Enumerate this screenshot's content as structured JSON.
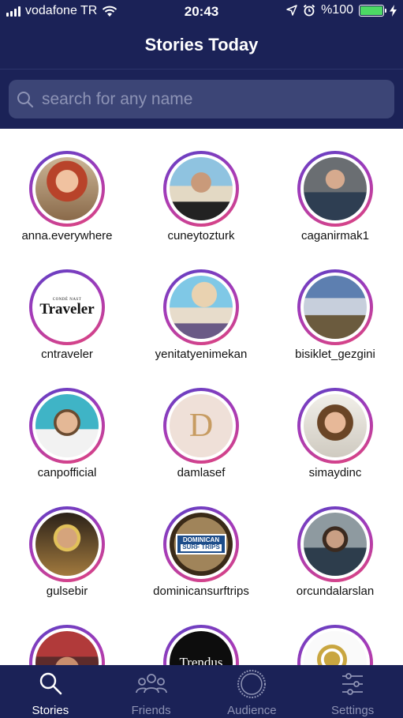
{
  "status_bar": {
    "carrier": "vodafone TR",
    "time": "20:43",
    "battery_percent": "%100",
    "battery_level": 1.0
  },
  "header": {
    "title": "Stories Today"
  },
  "search": {
    "placeholder": "search for any name"
  },
  "stories": [
    {
      "username": "anna.everywhere",
      "avatar": "woman-red-hair"
    },
    {
      "username": "cuneytozturk",
      "avatar": "man-beach-sunglasses"
    },
    {
      "username": "caganirmak1",
      "avatar": "man-bald-arms-crossed"
    },
    {
      "username": "cntraveler",
      "avatar": "logo-traveler",
      "logo_top": "CONDÉ NAST",
      "logo_main": "Traveler"
    },
    {
      "username": "yenitatyenimekan",
      "avatar": "woman-hat-beach"
    },
    {
      "username": "bisiklet_gezgini",
      "avatar": "bicycles-sky"
    },
    {
      "username": "canpofficial",
      "avatar": "man-smiling-sea"
    },
    {
      "username": "damlasef",
      "avatar": "logo-letter-d",
      "logo_main": "D"
    },
    {
      "username": "simaydinc",
      "avatar": "woman-smiling"
    },
    {
      "username": "gulsebir",
      "avatar": "woman-short-hair"
    },
    {
      "username": "dominicansurftrips",
      "avatar": "logo-dominican-surf",
      "logo_line1": "DOMINICAN",
      "logo_line2": "SURF TRIPS"
    },
    {
      "username": "orcundalarslan",
      "avatar": "man-beard-mountain"
    },
    {
      "username": "",
      "avatar": "person-sunglasses-headwrap"
    },
    {
      "username": "",
      "avatar": "logo-trendus",
      "logo_main": "Trendus"
    },
    {
      "username": "",
      "avatar": "logo-bird"
    }
  ],
  "tabbar": {
    "tabs": [
      {
        "label": "Stories",
        "icon": "search-icon",
        "active": true
      },
      {
        "label": "Friends",
        "icon": "people-icon",
        "active": false
      },
      {
        "label": "Audience",
        "icon": "circle-icon",
        "active": false
      },
      {
        "label": "Settings",
        "icon": "sliders-icon",
        "active": false
      }
    ]
  },
  "colors": {
    "header_bg": "#1b2257",
    "search_bg": "#3c4576",
    "ring_gradient": [
      "#5b3fc4",
      "#a63bb8",
      "#e0457d"
    ],
    "battery_fill": "#4cd964"
  }
}
